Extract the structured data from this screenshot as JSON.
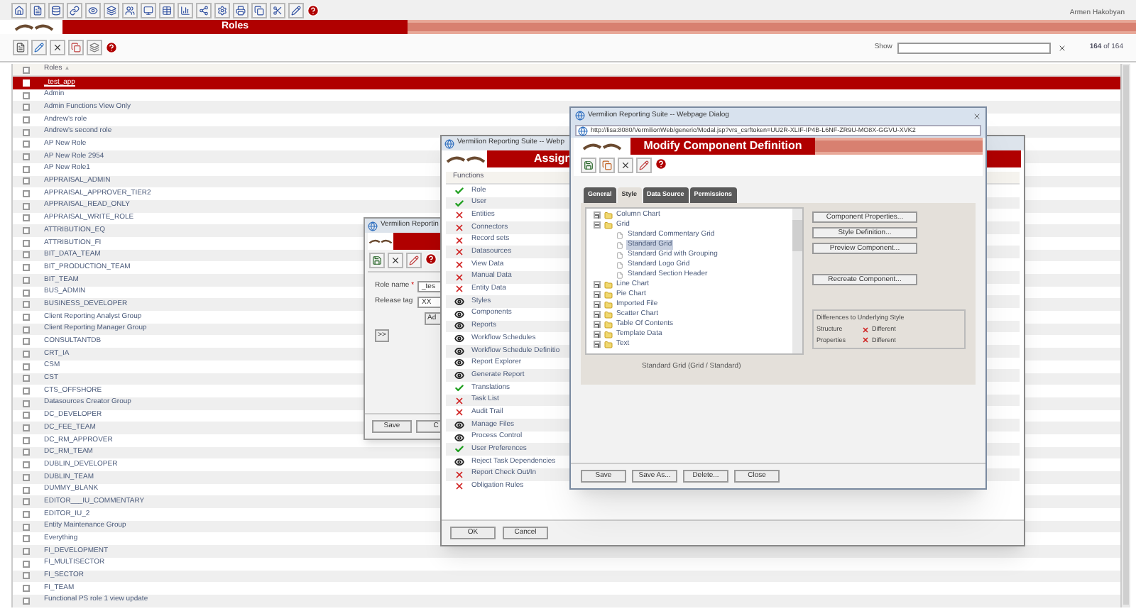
{
  "header": {
    "user_name": "Armen Hakobyan",
    "title": "Roles"
  },
  "list_toolbar": {
    "show_label": "Show",
    "count": "**164** of 164"
  },
  "table": {
    "header_checkbox": {
      "checked": false
    },
    "column": "Roles",
    "sort_indicator": "▲",
    "rows": [
      {
        "name": "_test_app",
        "selected": true
      },
      {
        "name": "Admin",
        "selected": false
      },
      {
        "name": "Admin Functions View Only",
        "selected": false
      },
      {
        "name": "Andrew's role",
        "selected": false
      },
      {
        "name": "Andrew's second role",
        "selected": false
      },
      {
        "name": "AP New Role",
        "selected": false
      },
      {
        "name": "AP New Role 2954",
        "selected": false
      },
      {
        "name": "AP New Role1",
        "selected": false
      },
      {
        "name": "APPRAISAL_ADMIN",
        "selected": false
      },
      {
        "name": "APPRAISAL_APPROVER_TIER2",
        "selected": false
      },
      {
        "name": "APPRAISAL_READ_ONLY",
        "selected": false
      },
      {
        "name": "APPRAISAL_WRITE_ROLE",
        "selected": false
      },
      {
        "name": "ATTRIBUTION_EQ",
        "selected": false
      },
      {
        "name": "ATTRIBUTION_FI",
        "selected": false
      },
      {
        "name": "BIT_DATA_TEAM",
        "selected": false
      },
      {
        "name": "BIT_PRODUCTION_TEAM",
        "selected": false
      },
      {
        "name": "BIT_TEAM",
        "selected": false
      },
      {
        "name": "BUS_ADMIN",
        "selected": false
      },
      {
        "name": "BUSINESS_DEVELOPER",
        "selected": false
      },
      {
        "name": "Client Reporting Analyst Group",
        "selected": false
      },
      {
        "name": "Client Reporting Manager Group",
        "selected": false
      },
      {
        "name": "CONSULTANTDB",
        "selected": false
      },
      {
        "name": "CRT_IA",
        "selected": false
      },
      {
        "name": "CSM",
        "selected": false
      },
      {
        "name": "CST",
        "selected": false
      },
      {
        "name": "CTS_OFFSHORE",
        "selected": false
      },
      {
        "name": "Datasources Creator Group",
        "selected": false
      },
      {
        "name": "DC_DEVELOPER",
        "selected": false
      },
      {
        "name": "DC_FEE_TEAM",
        "selected": false
      },
      {
        "name": "DC_RM_APPROVER",
        "selected": false
      },
      {
        "name": "DC_RM_TEAM",
        "selected": false
      },
      {
        "name": "DUBLIN_DEVELOPER",
        "selected": false
      },
      {
        "name": "DUBLIN_TEAM",
        "selected": false
      },
      {
        "name": "DUMMY_BLANK",
        "selected": false
      },
      {
        "name": "EDITOR___IU_COMMENTARY",
        "selected": false
      },
      {
        "name": "EDITOR_IU_2",
        "selected": false
      },
      {
        "name": "Entity Maintenance Group",
        "selected": false
      },
      {
        "name": "Everything",
        "selected": false
      },
      {
        "name": "FI_DEVELOPMENT",
        "selected": false
      },
      {
        "name": "FI_MULTISECTOR",
        "selected": false
      },
      {
        "name": "FI_SECTOR",
        "selected": false
      },
      {
        "name": "FI_TEAM",
        "selected": false
      },
      {
        "name": "Functional PS role 1 view update",
        "selected": false
      }
    ]
  },
  "role_dialog": {
    "title": "Vermilion Reportin",
    "role_name_label": "Role name",
    "required_mark": "*",
    "role_name_value": "_tes",
    "release_tag_label": "Release tag",
    "release_tag_value": "XX",
    "add_button": "Ad",
    "move_button": ">>",
    "save_button": "Save",
    "second_button": "C"
  },
  "assign_dialog": {
    "title": "Vermilion Reporting Suite -- Webp",
    "banner": "Assign",
    "column": "Functions",
    "functions": [
      {
        "name": "Role",
        "kind": "full"
      },
      {
        "name": "User",
        "kind": "full"
      },
      {
        "name": "Entities",
        "kind": "none"
      },
      {
        "name": "Connectors",
        "kind": "none"
      },
      {
        "name": "Record sets",
        "kind": "none"
      },
      {
        "name": "Datasources",
        "kind": "none"
      },
      {
        "name": "View Data",
        "kind": "none"
      },
      {
        "name": "Manual Data",
        "kind": "none"
      },
      {
        "name": "Entity Data",
        "kind": "none"
      },
      {
        "name": "Styles",
        "kind": "view"
      },
      {
        "name": "Components",
        "kind": "view"
      },
      {
        "name": "Reports",
        "kind": "view"
      },
      {
        "name": "Workflow Schedules",
        "kind": "view"
      },
      {
        "name": "Workflow Schedule Definitio",
        "kind": "view"
      },
      {
        "name": "Report Explorer",
        "kind": "view"
      },
      {
        "name": "Generate Report",
        "kind": "view"
      },
      {
        "name": "Translations",
        "kind": "full"
      },
      {
        "name": "Task List",
        "kind": "none"
      },
      {
        "name": "Audit Trail",
        "kind": "none"
      },
      {
        "name": "Manage Files",
        "kind": "view"
      },
      {
        "name": "Process Control",
        "kind": "view"
      },
      {
        "name": "User Preferences",
        "kind": "full"
      },
      {
        "name": "Reject Task Dependencies",
        "kind": "view"
      },
      {
        "name": "Report Check Out/In",
        "kind": "none"
      },
      {
        "name": "Obligation Rules",
        "kind": "none"
      }
    ],
    "buttons": [
      "OK",
      "Cancel"
    ]
  },
  "modify_dialog": {
    "title": "Vermilion Reporting Suite -- Webpage Dialog",
    "url": "http://lisa:8080/VermilionWeb/generic/Modal.jsp?vrs_csrftoken=UU2R-XLIF-IP4B-L6NF-ZR9U-MO8X-GGVU-XVK2",
    "banner": "Modify Component Definition",
    "tabs": [
      {
        "label": "General",
        "selected": false
      },
      {
        "label": "Style",
        "selected": true
      },
      {
        "label": "Data Source",
        "selected": false
      },
      {
        "label": "Permissions",
        "selected": false
      }
    ],
    "tree": [
      {
        "label": "Column Chart",
        "expanded": false
      },
      {
        "label": "Grid",
        "expanded": true,
        "children": [
          {
            "label": "Standard Commentary Grid",
            "selected": false
          },
          {
            "label": "Standard Grid",
            "selected": true
          },
          {
            "label": "Standard Grid with Grouping",
            "selected": false
          },
          {
            "label": "Standard Logo Grid",
            "selected": false
          },
          {
            "label": "Standard Section Header",
            "selected": false
          }
        ]
      },
      {
        "label": "Line Chart",
        "expanded": false
      },
      {
        "label": "Pie Chart",
        "expanded": false
      },
      {
        "label": "Imported File",
        "expanded": false
      },
      {
        "label": "Scatter Chart",
        "expanded": false
      },
      {
        "label": "Table Of Contents",
        "expanded": false
      },
      {
        "label": "Template Data",
        "expanded": false
      },
      {
        "label": "Text",
        "expanded": false
      }
    ],
    "actions": [
      "Component Properties...",
      "Style Definition...",
      "Preview Component...",
      "Recreate Component..."
    ],
    "differences": {
      "title": "Differences to Underlying Style",
      "items": [
        {
          "label": "Structure",
          "value": "Different"
        },
        {
          "label": "Properties",
          "value": "Different"
        }
      ]
    },
    "caption": "Standard Grid (Grid / Standard)",
    "buttons": [
      "Save",
      "Save As...",
      "Delete...",
      "Close"
    ]
  }
}
